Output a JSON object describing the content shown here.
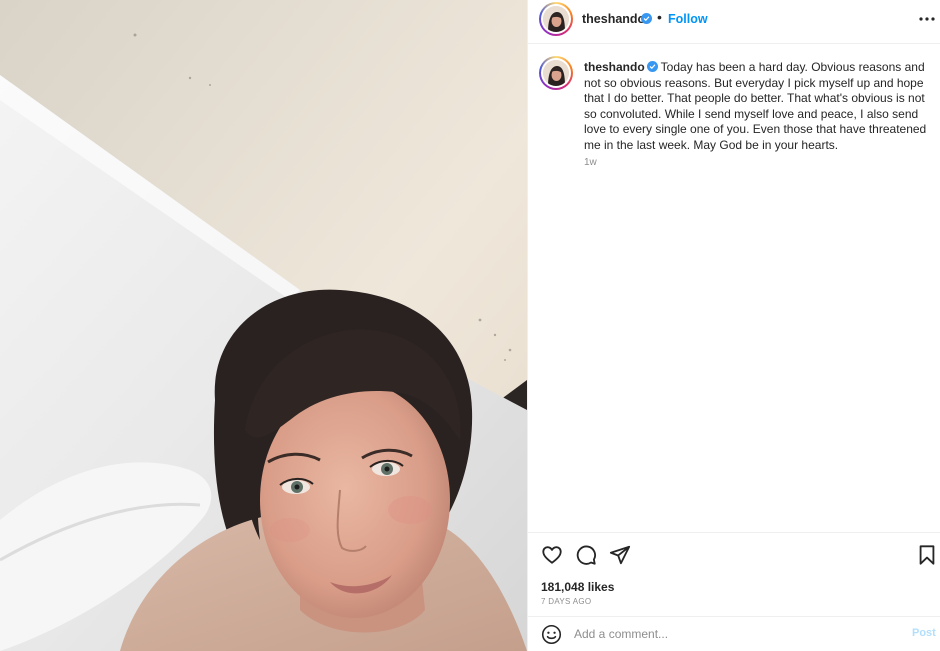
{
  "post": {
    "username": "theshando",
    "follow_label": "Follow",
    "separator": "•",
    "caption_text": "Today has been a hard day. Obvious reasons and not so obvious reasons. But everyday I pick myself up and hope that I do better. That people do better. That what's obvious is not so convoluted. While I send myself love and peace, I also send love to every single one of you. Even those that have threatened me in the last week. May God be in your hearts.",
    "time_ago": "1w",
    "likes": "181,048 likes",
    "date": "7 DAYS AGO"
  },
  "comment": {
    "placeholder": "Add a comment...",
    "post_label": "Post"
  },
  "colors": {
    "link_blue": "#0095f6",
    "verified_blue": "#3897f0",
    "post_disabled": "#b2dffc",
    "muted_text": "#8e8e8e"
  },
  "icons": {
    "header_more": "more-horizontal-icon",
    "like": "heart-icon",
    "comment": "comment-bubble-icon",
    "share": "paper-plane-icon",
    "save": "bookmark-icon",
    "emoji": "smiley-face-icon",
    "verified": "verified-badge-icon"
  }
}
